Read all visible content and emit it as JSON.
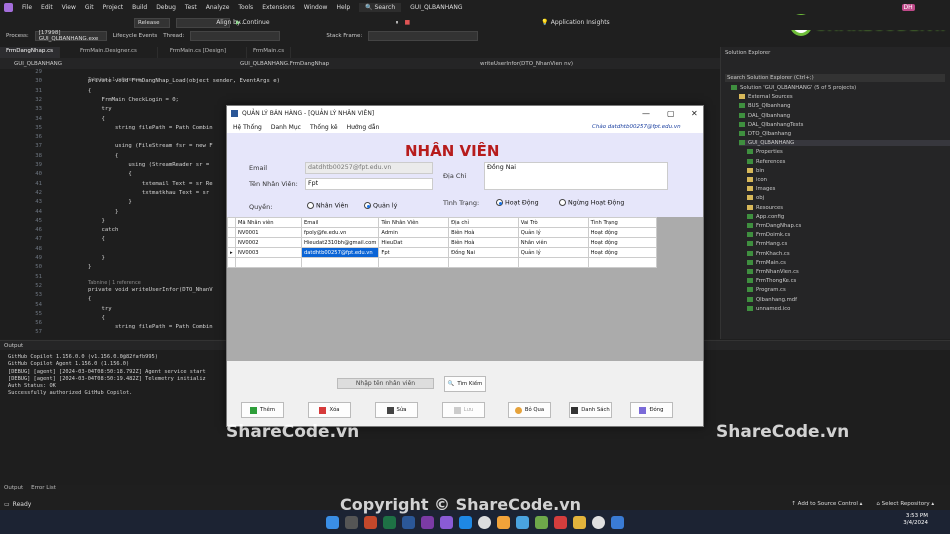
{
  "ide": {
    "menu": [
      "File",
      "Edit",
      "View",
      "Git",
      "Project",
      "Build",
      "Debug",
      "Test",
      "Analyze",
      "Tools",
      "Extensions",
      "Window",
      "Help"
    ],
    "search": "Search",
    "solution_title": "GUI_QLBANHANG",
    "config": "Release",
    "continue_label": "Continue",
    "app_insights": "Application Insights",
    "process_label": "Process:",
    "process_value": "[17998] GUI_QLBANHANG.exe",
    "lifecycle": "Lifecycle Events",
    "thread": "Thread:",
    "stack_frame": "Stack Frame:",
    "align_by": "Align by...",
    "user_initials": "DH"
  },
  "tabs": [
    "FrmDangNhap.cs",
    "FrmMain.Designer.cs",
    "FrmMain.cs [Design]",
    "FrmMain.cs"
  ],
  "nav": {
    "project": "GUI_QLBANHANG",
    "class": "GUI_QLBANHANG.FrmDangNhap",
    "member": "writeUserInfor(DTO_NhanVien nv)"
  },
  "code": {
    "ref1": "Tabnine | 1 reference",
    "ref2": "Tabnine | 1 reference",
    "lines": [
      {
        "n": "29",
        "t": ""
      },
      {
        "n": "30",
        "t": "private void FrmDangNhap_Load(object sender, EventArgs e)"
      },
      {
        "n": "31",
        "t": "{"
      },
      {
        "n": "32",
        "t": "    FrmMain CheckLogin = 0;"
      },
      {
        "n": "33",
        "t": "    try"
      },
      {
        "n": "34",
        "t": "    {"
      },
      {
        "n": "35",
        "t": "        string filePath = Path Combin"
      },
      {
        "n": "36",
        "t": ""
      },
      {
        "n": "37",
        "t": "        using (FileStream fsr = new F"
      },
      {
        "n": "38",
        "t": "        {"
      },
      {
        "n": "39",
        "t": "            using (StreamReader sr = "
      },
      {
        "n": "40",
        "t": "            {"
      },
      {
        "n": "41",
        "t": "                txtemail Text = sr Re"
      },
      {
        "n": "42",
        "t": "                txtmatkhau Text = sr"
      },
      {
        "n": "43",
        "t": "            }"
      },
      {
        "n": "44",
        "t": "        }"
      },
      {
        "n": "45",
        "t": "    }"
      },
      {
        "n": "46",
        "t": "    catch"
      },
      {
        "n": "47",
        "t": "    {"
      },
      {
        "n": "48",
        "t": ""
      },
      {
        "n": "49",
        "t": "    }"
      },
      {
        "n": "50",
        "t": "}"
      },
      {
        "n": "51",
        "t": ""
      },
      {
        "n": "52",
        "t": "private void writeUserInfor(DTO_NhanV"
      },
      {
        "n": "53",
        "t": "{"
      },
      {
        "n": "54",
        "t": "    try"
      },
      {
        "n": "55",
        "t": "    {"
      },
      {
        "n": "56",
        "t": "        string filePath = Path Combin"
      },
      {
        "n": "57",
        "t": ""
      }
    ]
  },
  "output": {
    "title": "Output",
    "lines": [
      "GitHub Copilot 1.156.0.0 (v1.156.0.0@82fafb995)",
      "GitHub Copilot Agent 1.156.0 (1.156.0)",
      "[DEBUG] [agent] [2024-03-04T08:50:18.792Z] Agent service start",
      "[DEBUG] [agent] [2024-03-04T08:50:19.482Z] Telemetry initializ",
      "Auth Status: OK",
      "Successfully authorized GitHub Copilot."
    ]
  },
  "bottom_tabs": [
    "Output",
    "Error List"
  ],
  "status": {
    "ready": "Ready",
    "source_control": "Add to Source Control",
    "repo": "Select Repository"
  },
  "clock": {
    "time": "3:53 PM",
    "date": "3/4/2024"
  },
  "solution_explorer": {
    "title": "Solution Explorer",
    "search": "Search Solution Explorer (Ctrl+;)",
    "items": [
      {
        "t": "Solution 'GUI_QLBANHANG' (5 of 5 projects)",
        "d": 0,
        "k": "sln"
      },
      {
        "t": "External Sources",
        "d": 1,
        "k": "fold"
      },
      {
        "t": "BUS_Qlbanhang",
        "d": 1,
        "k": "cs"
      },
      {
        "t": "DAL_Qlbanhang",
        "d": 1,
        "k": "cs"
      },
      {
        "t": "DAL_QlbanhangTests",
        "d": 1,
        "k": "cs"
      },
      {
        "t": "DTO_Qlbanhang",
        "d": 1,
        "k": "cs"
      },
      {
        "t": "GUI_QLBANHANG",
        "d": 1,
        "k": "cs"
      },
      {
        "t": "Properties",
        "d": 2,
        "k": "cs"
      },
      {
        "t": "References",
        "d": 2,
        "k": "cs"
      },
      {
        "t": "bin",
        "d": 2,
        "k": "fold"
      },
      {
        "t": "icon",
        "d": 2,
        "k": "fold"
      },
      {
        "t": "Images",
        "d": 2,
        "k": "fold"
      },
      {
        "t": "obj",
        "d": 2,
        "k": "fold"
      },
      {
        "t": "Resources",
        "d": 2,
        "k": "fold"
      },
      {
        "t": "App.config",
        "d": 2,
        "k": "cs"
      },
      {
        "t": "FrmDangNhap.cs",
        "d": 2,
        "k": "cs"
      },
      {
        "t": "FrmDoimk.cs",
        "d": 2,
        "k": "cs"
      },
      {
        "t": "FrmHang.cs",
        "d": 2,
        "k": "cs"
      },
      {
        "t": "FrmKhach.cs",
        "d": 2,
        "k": "cs"
      },
      {
        "t": "FrmMain.cs",
        "d": 2,
        "k": "cs"
      },
      {
        "t": "FrmNhanVien.cs",
        "d": 2,
        "k": "cs"
      },
      {
        "t": "FrmThongKe.cs",
        "d": 2,
        "k": "cs"
      },
      {
        "t": "Program.cs",
        "d": 2,
        "k": "cs"
      },
      {
        "t": "Qlbanhang.mdf",
        "d": 2,
        "k": "cs"
      },
      {
        "t": "unnamed.ico",
        "d": 2,
        "k": "cs"
      }
    ]
  },
  "form": {
    "title": "QUẢN LÝ BÁN HÀNG - [QUẢN LÝ NHÂN VIÊN]",
    "menu": [
      "Hệ Thống",
      "Danh Mục",
      "Thống kê",
      "Hướng dẫn"
    ],
    "greeting": "Chào datdhtb00257@fpt.edu.vn",
    "heading": "NHÂN VIÊN",
    "email_label": "Email",
    "email_value": "datdhtb00257@fpt.edu.vn",
    "name_label": "Tên Nhân Viên:",
    "name_value": "Fpt",
    "address_label": "Địa Chỉ",
    "address_value": "Đồng Nai",
    "role_label": "Quyền:",
    "role_options": [
      "Nhân Viên",
      "Quản lý"
    ],
    "status_label": "Tình Trạng:",
    "status_options": [
      "Hoạt Động",
      "Ngừng Hoạt Động"
    ],
    "columns": [
      "Mã Nhân viên",
      "Email",
      "Tên Nhân Viên",
      "Địa chỉ",
      "Vai Trò",
      "Tình Trạng"
    ],
    "rows": [
      [
        "NV0001",
        "fpoly@fe.edu.vn",
        "Admin",
        "Biên Hoà",
        "Quản lý",
        "Hoạt động"
      ],
      [
        "NV0002",
        "Hieudat2310bh@gmail.com",
        "HieuDat",
        "Biên Hoà",
        "Nhân viên",
        "Hoạt động"
      ],
      [
        "NV0003",
        "datdhtb00257@fpt.edu.vn",
        "Fpt",
        "Đồng Nai",
        "Quản lý",
        "Hoạt động"
      ]
    ],
    "search_placeholder": "Nhập tên nhân viên",
    "search_button": "Tìm Kiếm",
    "buttons": [
      "Thêm",
      "Xóa",
      "Sửa",
      "Lưu",
      "Bỏ Qua",
      "Danh Sách",
      "Đóng"
    ]
  },
  "watermarks": {
    "logo": "SHARECODE.vn",
    "left": "ShareCode.vn",
    "right": "ShareCode.vn",
    "bottom": "Copyright © ShareCode.vn"
  },
  "colors": {
    "heading": "#b71c1c",
    "panel": "#e6e6fa",
    "accent": "#1a73e8",
    "ide_bg": "#1e1e1e"
  }
}
